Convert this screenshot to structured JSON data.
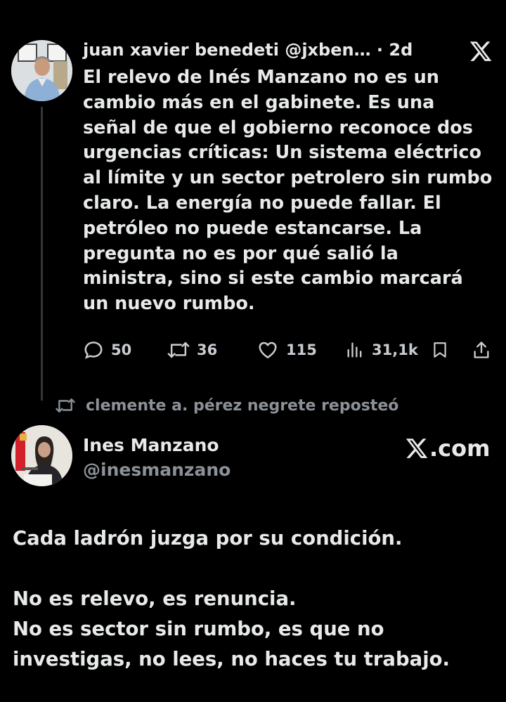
{
  "tweet": {
    "author_name": "juan xavier benedeti",
    "author_handle": "@jxben…",
    "age": "· 2d",
    "text": "El relevo de Inés Manzano no es un cambio más en el gabinete. Es una señal de que el gobierno reconoce dos urgencias críticas: Un sistema eléctrico al límite y un sector petrolero sin rumbo claro. La energía no puede fallar. El petróleo no puede estancarse. La pregunta no es por qué salió la ministra, sino si este cambio marcará un nuevo rumbo.",
    "replies": "50",
    "reposts": "36",
    "likes": "115",
    "views": "31,1k",
    "x_icon": "x-logo-icon"
  },
  "repost_notice": {
    "text": "clemente a. pérez negrete reposteó",
    "icon": "repost-icon"
  },
  "quoted": {
    "author_name": "Ines Manzano",
    "author_handle": "@inesmanzano",
    "brand": ".com",
    "lines": [
      "Cada ladrón juzga por su condición.",
      "No es relevo, es renuncia.",
      "No es sector sin rumbo, es que no investigas, no lees, no haces tu trabajo."
    ]
  },
  "colors": {
    "background": "#000000",
    "text": "#e7e9ea",
    "muted": "#8b9197",
    "thread_line": "#333639"
  }
}
